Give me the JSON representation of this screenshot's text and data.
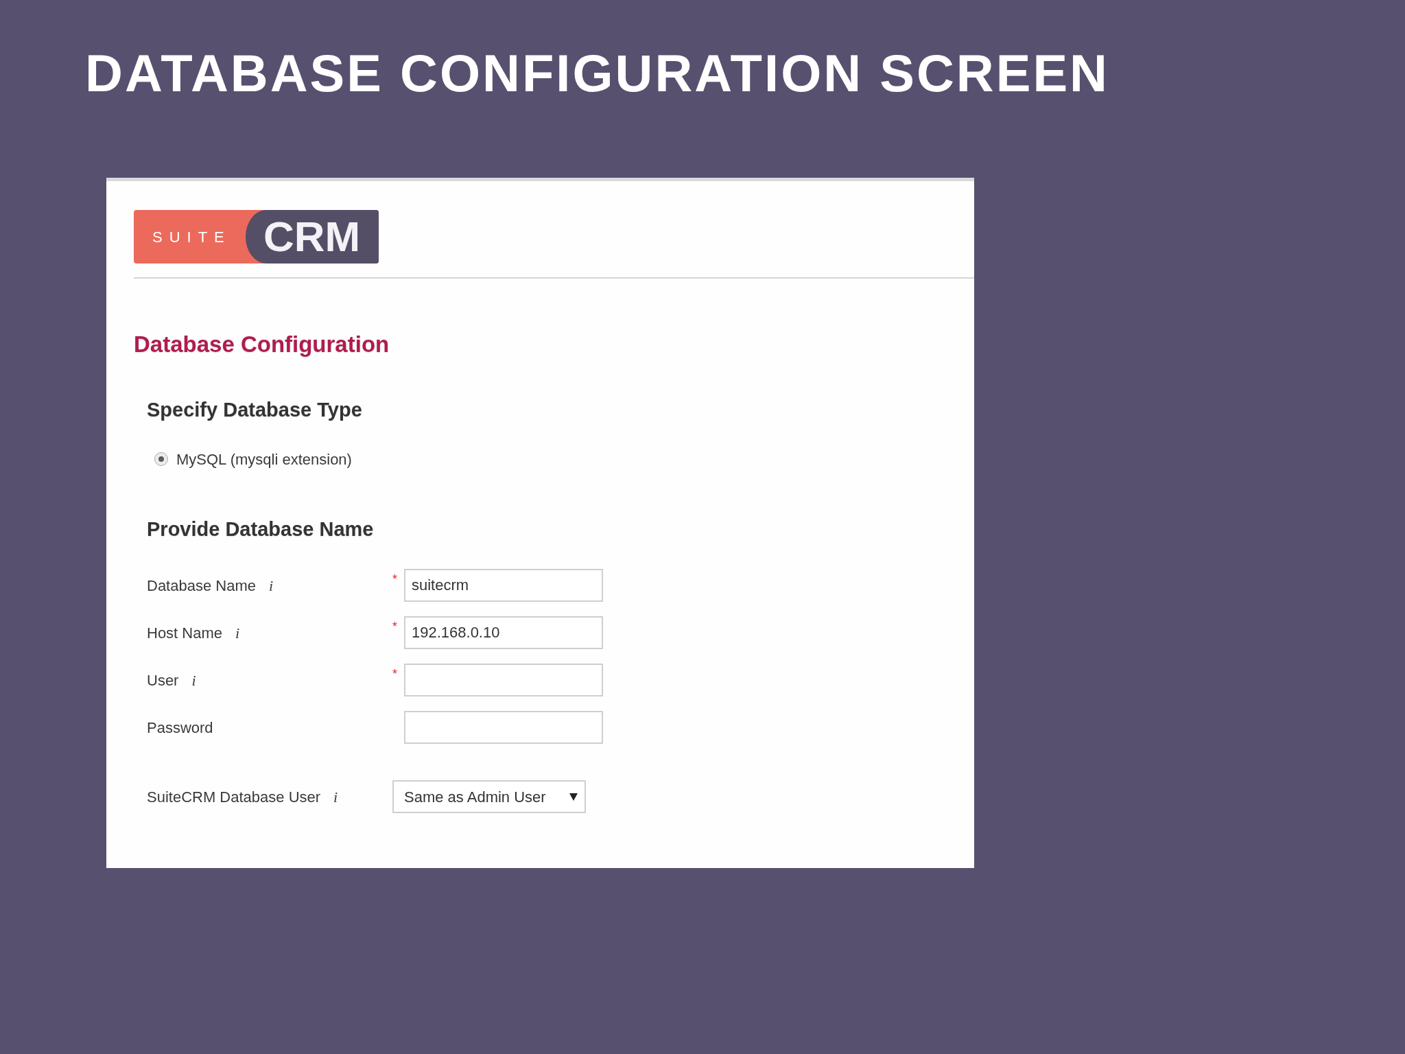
{
  "slide_title": "DATABASE CONFIGURATION SCREEN",
  "logo": {
    "prefix": "SUITE",
    "name": "CRM"
  },
  "page_title": "Database Configuration",
  "sections": [
    {
      "kind": "radios",
      "heading": "Specify Database Type",
      "options": [
        {
          "label": "MySQL (mysqli extension)",
          "selected": true
        }
      ]
    },
    {
      "kind": "fields",
      "heading": "Provide Database Name",
      "fields": [
        {
          "kind": "text",
          "label": "Database Name",
          "info": "i",
          "required_mark": "*",
          "value": "suitecrm"
        },
        {
          "kind": "text",
          "label": "Host Name",
          "info": "i",
          "required_mark": "*",
          "value": "192.168.0.10"
        },
        {
          "kind": "text",
          "label": "User",
          "info": "i",
          "required_mark": "*"
        },
        {
          "kind": "text",
          "label": "Password"
        },
        {
          "kind": "select",
          "label": "SuiteCRM Database User",
          "info": "i",
          "value": "Same as Admin User"
        }
      ]
    }
  ]
}
